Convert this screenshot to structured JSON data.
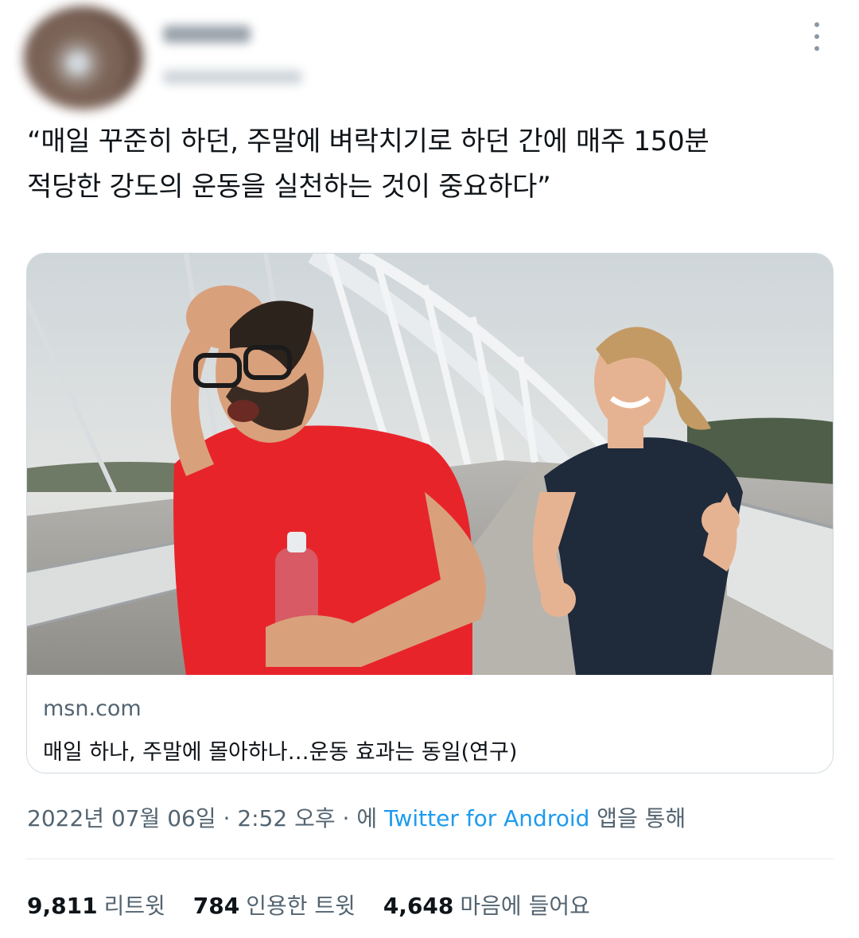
{
  "tweet": {
    "text_line1": "“매일 꾸준히 하던, 주말에 벼락치기로 하던 간에 매주 150분",
    "text_line2": "적당한 강도의 운동을 실천하는 것이 중요하다”"
  },
  "card": {
    "domain": "msn.com",
    "title": "매일 하나, 주말에 몰아하나…운동 효과는 동일(연구)"
  },
  "meta": {
    "date": "2022년 07월 06일",
    "separator": " · ",
    "time": "2:52 오후",
    "via_prefix": " · 에 ",
    "source": "Twitter for Android",
    "via_suffix": " 앱을 통해"
  },
  "stats": {
    "retweets_count": "9,811",
    "retweets_label": "리트윗",
    "quotes_count": "784",
    "quotes_label": "인용한 트윗",
    "likes_count": "4,648",
    "likes_label": "마음에 들어요"
  },
  "colors": {
    "link": "#1d9bf0",
    "secondary_text": "#536471",
    "primary_text": "#0f1419"
  },
  "icons": {
    "more": "more-vertical-icon"
  }
}
